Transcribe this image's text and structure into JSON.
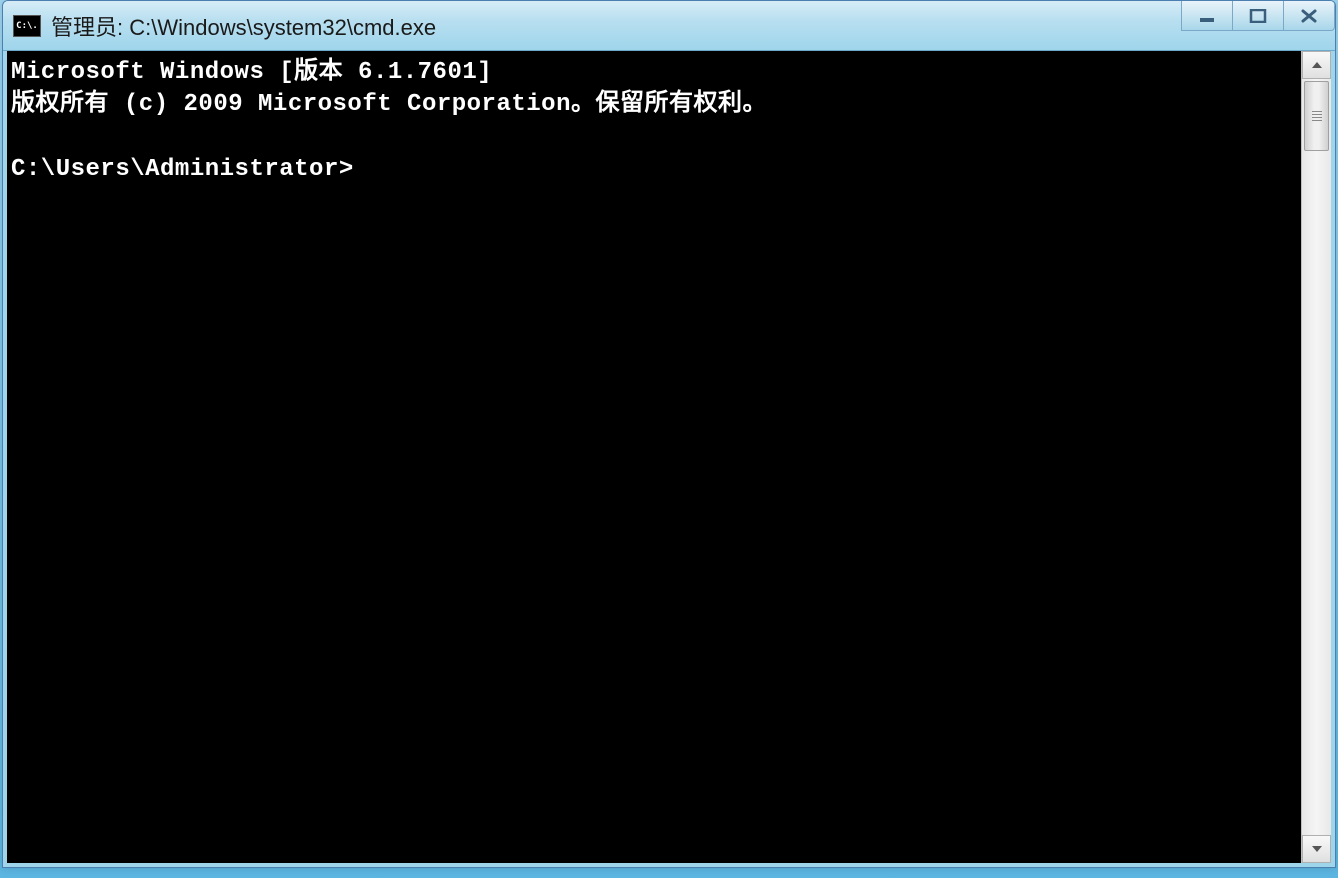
{
  "window": {
    "title": "管理员: C:\\Windows\\system32\\cmd.exe",
    "icon_label": "C:\\."
  },
  "console": {
    "line1": "Microsoft Windows [版本 6.1.7601]",
    "line2": "版权所有 (c) 2009 Microsoft Corporation。保留所有权利。",
    "blank": "",
    "prompt": "C:\\Users\\Administrator>"
  },
  "controls": {
    "minimize": "minimize",
    "maximize": "maximize",
    "close": "close"
  }
}
